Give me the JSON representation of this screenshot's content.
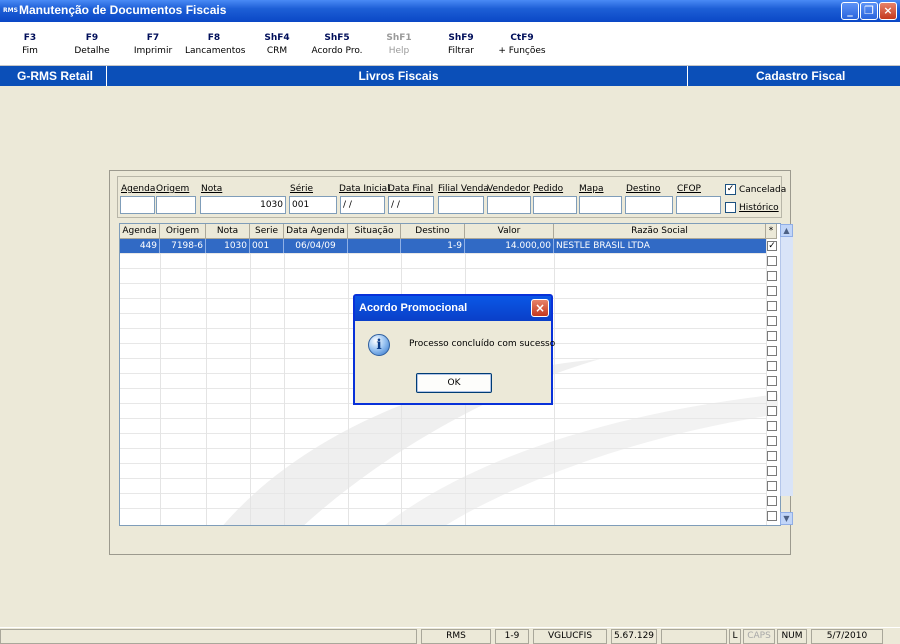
{
  "window": {
    "app_icon": "RMS",
    "title": "Manutenção de Documentos Fiscais"
  },
  "toolbar": [
    {
      "key": "F3",
      "label": "Fim",
      "enabled": true
    },
    {
      "key": "F9",
      "label": "Detalhe",
      "enabled": true
    },
    {
      "key": "F7",
      "label": "Imprimir",
      "enabled": true
    },
    {
      "key": "F8",
      "label": "Lancamentos",
      "enabled": true
    },
    {
      "key": "ShF4",
      "label": "CRM",
      "enabled": true
    },
    {
      "key": "ShF5",
      "label": "Acordo Pro.",
      "enabled": true
    },
    {
      "key": "ShF1",
      "label": "Help",
      "enabled": false
    },
    {
      "key": "ShF9",
      "label": "Filtrar",
      "enabled": true
    },
    {
      "key": "CtF9",
      "label": "+ Funções",
      "enabled": true
    }
  ],
  "header": {
    "left": "G-RMS Retail",
    "center": "Livros Fiscais",
    "right": "Cadastro Fiscal"
  },
  "filters": {
    "agenda": {
      "label": "Agenda",
      "value": ""
    },
    "origem": {
      "label": "Origem",
      "value": ""
    },
    "nota": {
      "label": "Nota",
      "value": "1030"
    },
    "serie": {
      "label": "Série",
      "value": "001"
    },
    "data_inicial": {
      "label": "Data Inicial",
      "value": " / /"
    },
    "data_final": {
      "label": "Data Final",
      "value": " / /"
    },
    "filial_venda": {
      "label": "Filial Venda",
      "value": ""
    },
    "vendedor": {
      "label": "Vendedor",
      "value": ""
    },
    "pedido": {
      "label": "Pedido",
      "value": ""
    },
    "mapa": {
      "label": "Mapa",
      "value": ""
    },
    "destino": {
      "label": "Destino",
      "value": ""
    },
    "cfop": {
      "label": "CFOP",
      "value": ""
    },
    "cancelada": {
      "label": "Cancelada",
      "checked": true
    },
    "historico": {
      "label": "Histórico",
      "checked": false
    }
  },
  "grid": {
    "columns": [
      "Agenda",
      "Origem",
      "Nota",
      "Serie",
      "Data Agenda",
      "Situação",
      "Destino",
      "Valor",
      "Razão Social",
      "*"
    ],
    "rows": [
      {
        "agenda": "449",
        "origem": "7198-6",
        "nota": "1030",
        "serie": "001",
        "data_agenda": "06/04/09",
        "situacao": "",
        "destino": "1-9",
        "valor": "14.000,00",
        "razao_social": "NESTLE BRASIL LTDA",
        "checked": true
      }
    ],
    "empty_rows": 18
  },
  "dialog": {
    "title": "Acordo Promocional",
    "message": "Processo concluído com sucesso",
    "ok_label": "OK"
  },
  "statusbar": {
    "panels": [
      "RMS",
      "1-9",
      "VGLUCFIS",
      "5.67.129",
      "",
      "L",
      "CAPS",
      "NUM",
      "5/7/2010"
    ]
  }
}
